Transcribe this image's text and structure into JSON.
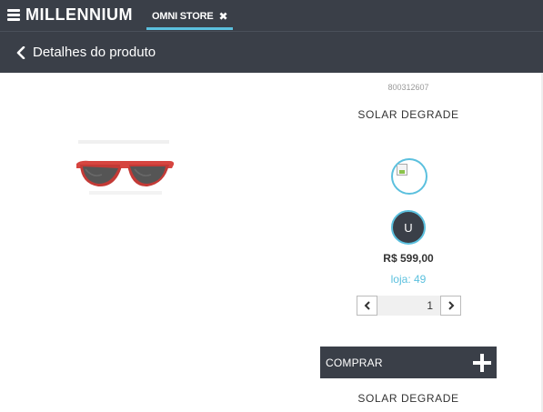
{
  "header": {
    "logo_text": "MILLENNIUM",
    "store_tab_label": "OMNI STORE",
    "close_glyph": "✖",
    "menu_icon": "hamburger-icon"
  },
  "subheader": {
    "back_label": "Detalhes do produto",
    "back_icon": "chevron-left-icon"
  },
  "product": {
    "sku": "800312607",
    "name": "SOLAR DEGRADE",
    "image_icon": "sunglasses-image",
    "color_swatch": "broken-image",
    "size_label": "U",
    "price": "R$ 599,00",
    "store_stock": "loja: 49",
    "quantity": "1",
    "buy_label": "COMPRAR",
    "buy_icon": "plus-icon",
    "footer_name": "SOLAR DEGRADE"
  },
  "colors": {
    "header_bg": "#3a3f48",
    "accent": "#5bc0de",
    "lens_frame": "#d64540"
  }
}
